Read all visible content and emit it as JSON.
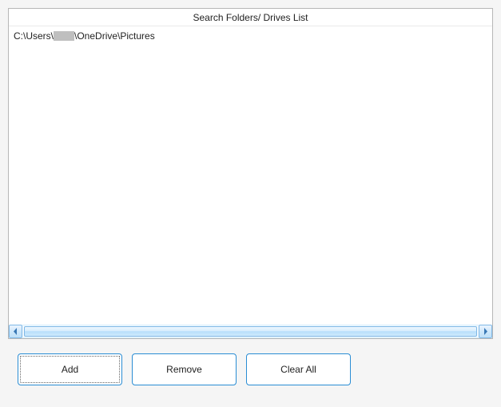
{
  "panel": {
    "title": "Search Folders/ Drives List",
    "items": [
      {
        "prefix": "C:\\Users\\",
        "suffix": "\\OneDrive\\Pictures"
      }
    ]
  },
  "buttons": {
    "add": "Add",
    "remove": "Remove",
    "clearAll": "Clear All"
  }
}
